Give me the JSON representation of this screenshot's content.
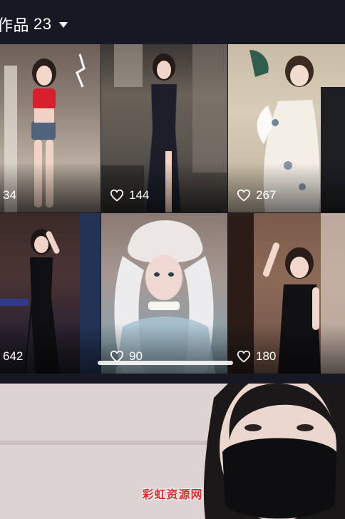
{
  "header": {
    "tab_label": "作品",
    "tab_count": "23"
  },
  "videos": [
    {
      "likes": "34"
    },
    {
      "likes": "144"
    },
    {
      "likes": "267"
    },
    {
      "likes": "642"
    },
    {
      "likes": "90"
    },
    {
      "likes": "180"
    }
  ],
  "watermark": "彩虹资源网",
  "colors": {
    "background": "#161823",
    "text": "#ffffff",
    "watermark": "#e3262b"
  }
}
